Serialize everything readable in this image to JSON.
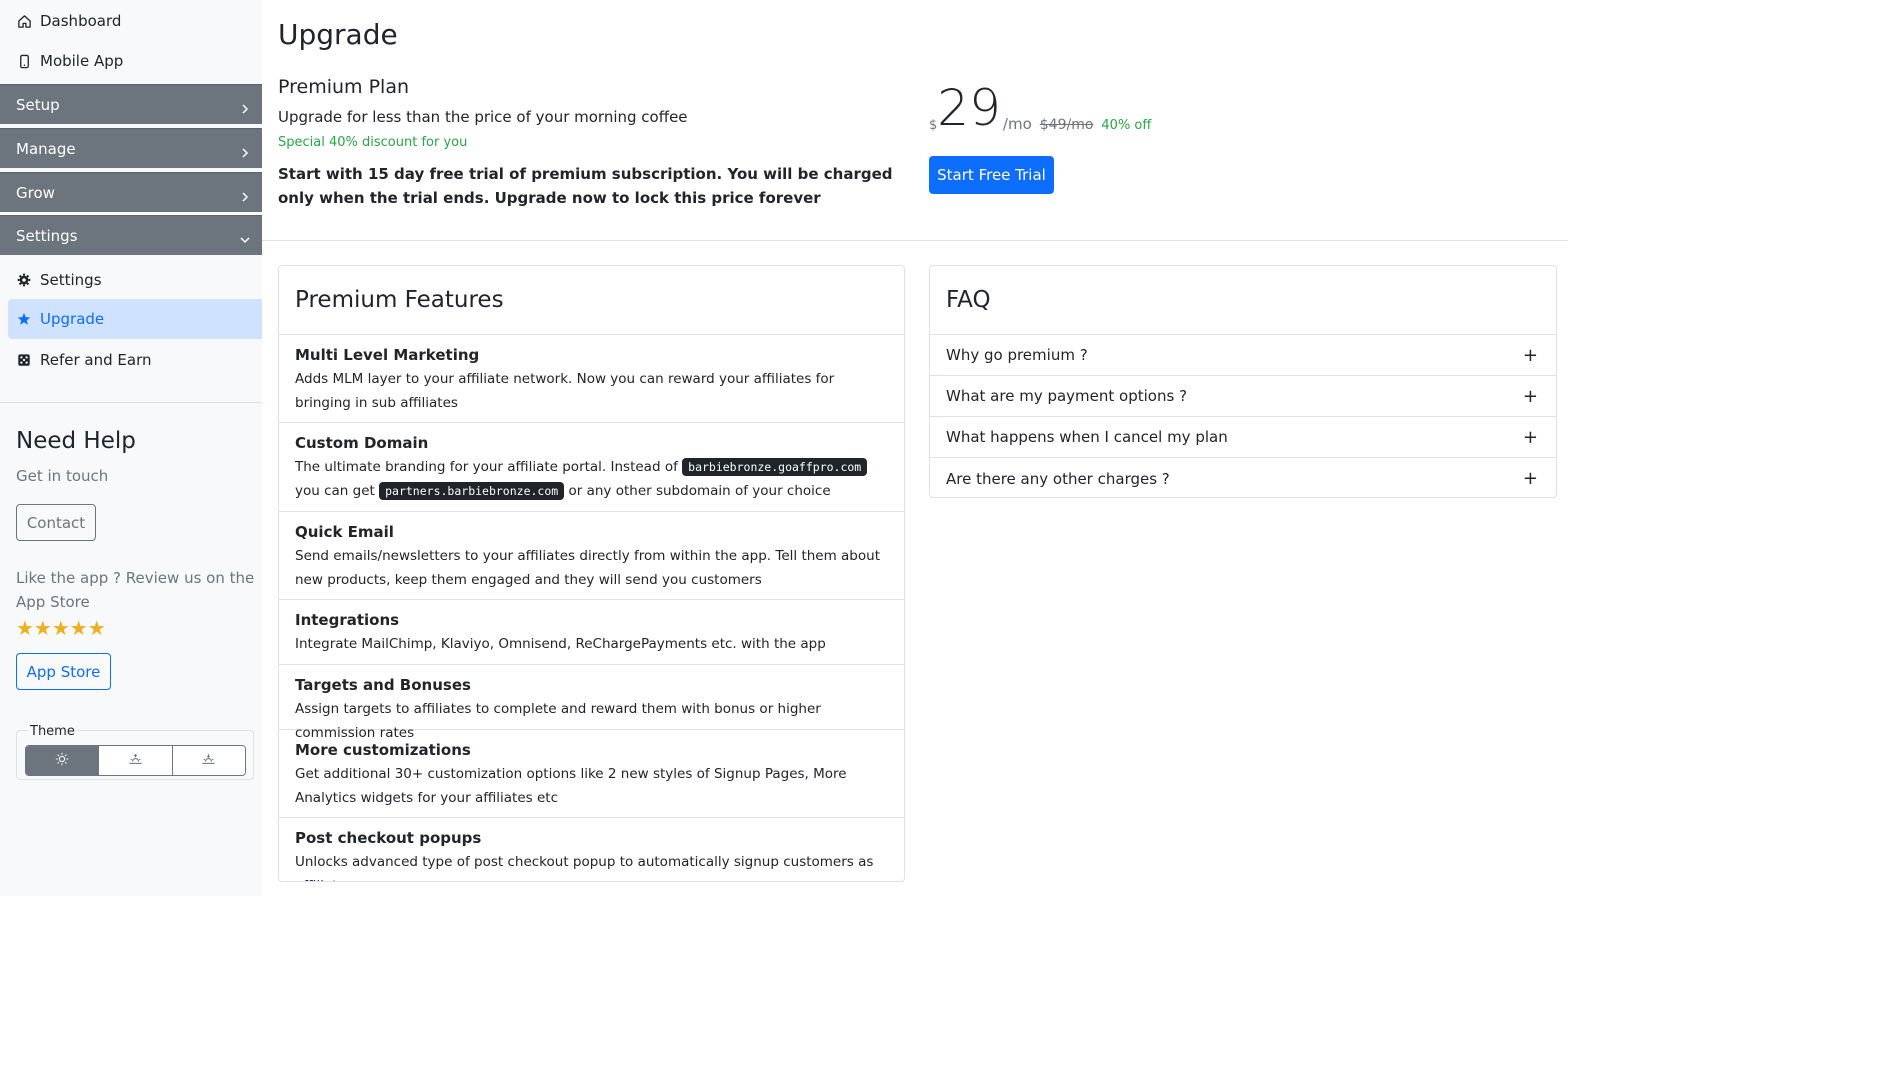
{
  "sidebar": {
    "top_links": [
      {
        "label": "Dashboard",
        "icon": "home-icon"
      },
      {
        "label": "Mobile App",
        "icon": "mobile-icon"
      }
    ],
    "groups": [
      {
        "label": "Setup",
        "icon": "chevron-right-icon"
      },
      {
        "label": "Manage",
        "icon": "chevron-right-icon"
      },
      {
        "label": "Grow",
        "icon": "chevron-right-icon"
      },
      {
        "label": "Settings",
        "icon": "chevron-down-icon"
      }
    ],
    "settings_links": [
      {
        "label": "Settings",
        "icon": "gear-icon"
      },
      {
        "label": "Upgrade",
        "icon": "star-icon",
        "active": true
      },
      {
        "label": "Refer and Earn",
        "icon": "dice-icon"
      }
    ],
    "help": {
      "title": "Need Help",
      "subtitle": "Get in touch",
      "contact_label": "Contact",
      "review_text": "Like the app ? Review us on the App Store",
      "stars": "★★★★★",
      "rating": 5,
      "appstore_label": "App Store"
    },
    "theme": {
      "label": "Theme",
      "options": [
        "sun-icon",
        "sunrise-icon",
        "sunset-icon"
      ],
      "selected": 0
    }
  },
  "main": {
    "title": "Upgrade",
    "plan": {
      "title": "Premium Plan",
      "subtitle": "Upgrade for less than the price of your morning coffee",
      "discount_note": "Special 40% discount for you",
      "trial_text": "Start with 15 day free trial of premium subscription. You will be charged only when the trial ends. Upgrade now to lock this price forever",
      "currency": "$",
      "price": "29",
      "per": "/mo",
      "old_price": "$49/mo",
      "off": "40% off",
      "cta": "Start Free Trial"
    },
    "features": {
      "title": "Premium Features",
      "items": [
        {
          "title": "Multi Level Marketing",
          "desc": "Adds MLM layer to your affiliate network. Now you can reward your affiliates for bringing in sub affiliates"
        },
        {
          "title": "Custom Domain",
          "desc_pre": "The ultimate branding for your affiliate portal. Instead of",
          "code1": "barbiebronze.goaffpro.com",
          "desc_mid": "you can get",
          "code2": "partners.barbiebronze.com",
          "desc_post": "or any other subdomain of your choice"
        },
        {
          "title": "Quick Email",
          "desc": "Send emails/newsletters to your affiliates directly from within the app. Tell them about new products, keep them engaged and they will send you customers"
        },
        {
          "title": "Integrations",
          "desc": "Integrate MailChimp, Klaviyo, Omnisend, ReChargePayments etc. with the app"
        },
        {
          "title": "Targets and Bonuses",
          "desc": "Assign targets to affiliates to complete and reward them with bonus or higher commission rates"
        },
        {
          "title": "More customizations",
          "desc": "Get additional 30+ customization options like 2 new styles of Signup Pages, More Analytics widgets for your affiliates etc"
        },
        {
          "title": "Post checkout popups",
          "desc": "Unlocks advanced type of post checkout popup to automatically signup customers as affiliate."
        }
      ]
    },
    "faq": {
      "title": "FAQ",
      "items": [
        "Why go premium ?",
        "What are my payment options ?",
        "What happens when I cancel my plan",
        "Are there any other charges ?"
      ],
      "expand_symbol": "+"
    }
  },
  "colors": {
    "primary": "#0d6efd",
    "secondary": "#6c757d",
    "success": "#28a745",
    "active_bg": "#cfe2ff",
    "star": "#f0ad1e"
  }
}
